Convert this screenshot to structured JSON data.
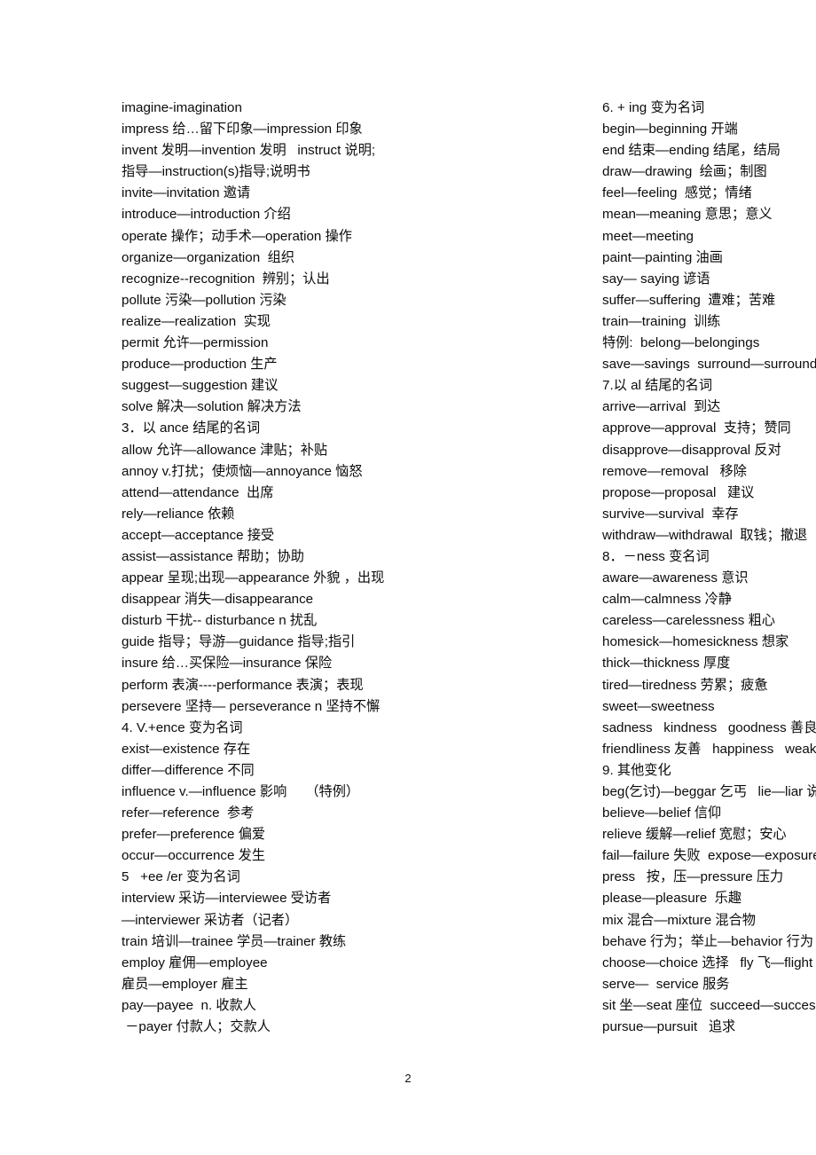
{
  "document": {
    "page_number": "2",
    "left_column": [
      "imagine-imagination",
      "impress 给…留下印象—impression 印象",
      "invent 发明—invention 发明   instruct 说明;",
      "指导—instruction(s)指导;说明书",
      "invite—invitation 邀请",
      "introduce—introduction 介绍",
      "operate 操作；动手术—operation 操作",
      "organize—organization  组织",
      "recognize--recognition  辨别；认出",
      "pollute 污染—pollution 污染",
      "realize—realization  实现",
      "permit 允许—permission",
      "produce—production 生产",
      "suggest—suggestion 建议",
      "solve 解决—solution 解决方法",
      "3．以 ance 结尾的名词",
      "allow 允许—allowance 津贴；补贴",
      "annoy v.打扰；使烦恼—annoyance 恼怒",
      "attend—attendance  出席",
      "rely—reliance 依赖",
      "accept—acceptance 接受",
      "assist—assistance 帮助；协助",
      "appear 呈现;出现—appearance 外貌 ，出现",
      "disappear 消失—disappearance",
      "disturb 干扰-- disturbance n 扰乱",
      "guide 指导；导游—guidance 指导;指引",
      "insure 给…买保险—insurance 保险",
      "perform 表演----performance 表演；表现",
      "persevere 坚持— perseverance n 坚持不懈",
      "4. V.+ence 变为名词",
      "exist—existence 存在",
      "differ—difference 不同",
      "influence v.—influence 影响     （特例）",
      "refer—reference  参考",
      "prefer—preference 偏爱",
      "occur—occurrence 发生",
      "5   +ee /er 变为名词",
      "interview 采访—interviewee 受访者",
      "—interviewer 采访者（记者）",
      "train 培训—trainee 学员—trainer 教练",
      "employ 雇佣—employee",
      "雇员—employer 雇主",
      "pay—payee  n. 收款人",
      " －payer 付款人；交款人"
    ],
    "right_column": [
      "6. + ing 变为名词",
      "begin—beginning 开端",
      "end 结束—ending 结尾，结局",
      "draw—drawing  绘画；制图",
      "feel—feeling  感觉；情绪",
      "mean—meaning 意思；意义",
      "meet—meeting",
      "paint—painting 油画",
      "say— saying 谚语",
      "suffer—suffering  遭难；苦难",
      "train—training  训练",
      "特例:  belong—belongings",
      "save—savings  surround—surroundings",
      "7.以 al 结尾的名词",
      "arrive—arrival  到达",
      "approve—approval  支持；赞同",
      "disapprove—disapproval 反对",
      "remove—removal   移除",
      "propose—proposal   建议",
      "survive—survival  幸存",
      "withdraw—withdrawal  取钱；撤退",
      "8．－ness 变名词",
      "aware—awareness 意识",
      "calm—calmness 冷静",
      "careless—carelessness 粗心",
      "homesick—homesickness 想家",
      "thick—thickness 厚度",
      "tired—tiredness 劳累；疲惫",
      "sweet—sweetness",
      "sadness   kindness   goodness 善良；良好",
      "friendliness 友善   happiness   weakness",
      "9. 其他变化",
      "beg(乞讨)—beggar 乞丐   lie—liar 说谎者",
      "believe—belief 信仰",
      "relieve 缓解—relief 宽慰；安心",
      "fail—failure 失败  expose—exposure 暴露",
      "press   按，压—pressure 压力",
      "please—pleasure  乐趣",
      "mix 混合—mixture 混合物",
      "behave 行为；举止—behavior 行为",
      "choose—choice 选择   fly 飞—flight 飞行",
      "serve—  service 服务",
      "sit 坐—seat 座位  succeed—success 成功",
      "pursue—pursuit   追求"
    ]
  }
}
